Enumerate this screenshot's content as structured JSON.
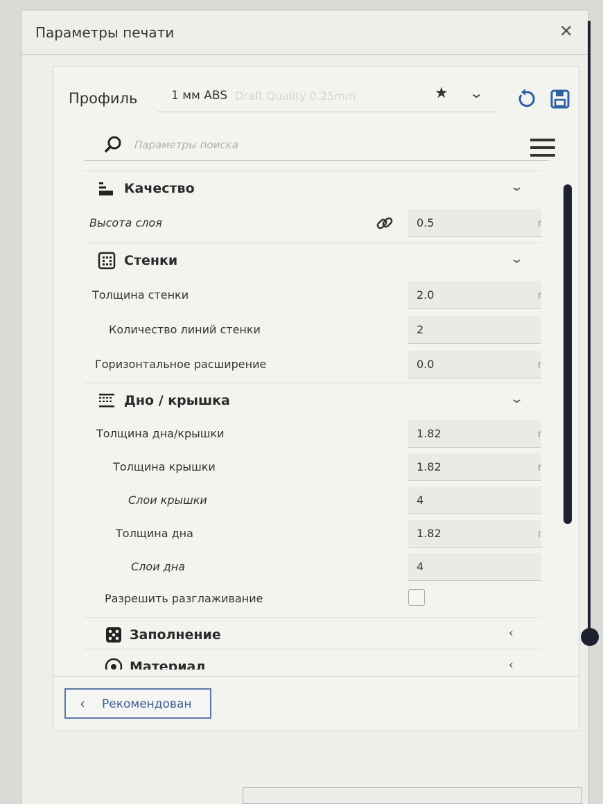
{
  "dialog": {
    "title": "Параметры печати",
    "close_glyph": "✕"
  },
  "profile": {
    "label": "Профиль",
    "name": "1 мм ABS",
    "subtitle": "Draft Quality 0.25mm"
  },
  "search": {
    "placeholder": "Параметры поиска"
  },
  "sections": {
    "quality": {
      "title": "Качество",
      "icon": "quality-bars-icon",
      "layer_height": {
        "label": "Высота слоя",
        "value": "0.5",
        "unit": "mm"
      }
    },
    "walls": {
      "title": "Стенки",
      "icon": "walls-grid-icon",
      "wall_thickness": {
        "label": "Толщина стенки",
        "value": "2.0",
        "unit": "mm"
      },
      "wall_line_count": {
        "label": "Количество линий стенки",
        "value": "2"
      },
      "horizontal_expansion": {
        "label": "Горизонтальное расширение",
        "value": "0.0",
        "unit": "mm"
      }
    },
    "top_bottom": {
      "title": "Дно / крышка",
      "icon": "layers-icon",
      "top_bottom_thickness": {
        "label": "Толщина дна/крышки",
        "value": "1.82",
        "unit": "mm"
      },
      "top_thickness": {
        "label": "Толщина крышки",
        "value": "1.82",
        "unit": "mm"
      },
      "top_layers": {
        "label": "Слои крышки",
        "value": "4"
      },
      "bottom_thickness": {
        "label": "Толщина дна",
        "value": "1.82",
        "unit": "mm"
      },
      "bottom_layers": {
        "label": "Слои дна",
        "value": "4"
      },
      "ironing": {
        "label": "Разрешить разглаживание",
        "checked": false
      }
    },
    "infill": {
      "title": "Заполнение",
      "icon": "infill-icon"
    },
    "material": {
      "title": "Материал",
      "icon": "material-icon"
    }
  },
  "footer": {
    "recommended_label": "Рекомендован"
  },
  "colors": {
    "accent": "#3d5e92",
    "icon_blue": "#2f5fa0",
    "scrollbar": "#1e2230"
  }
}
